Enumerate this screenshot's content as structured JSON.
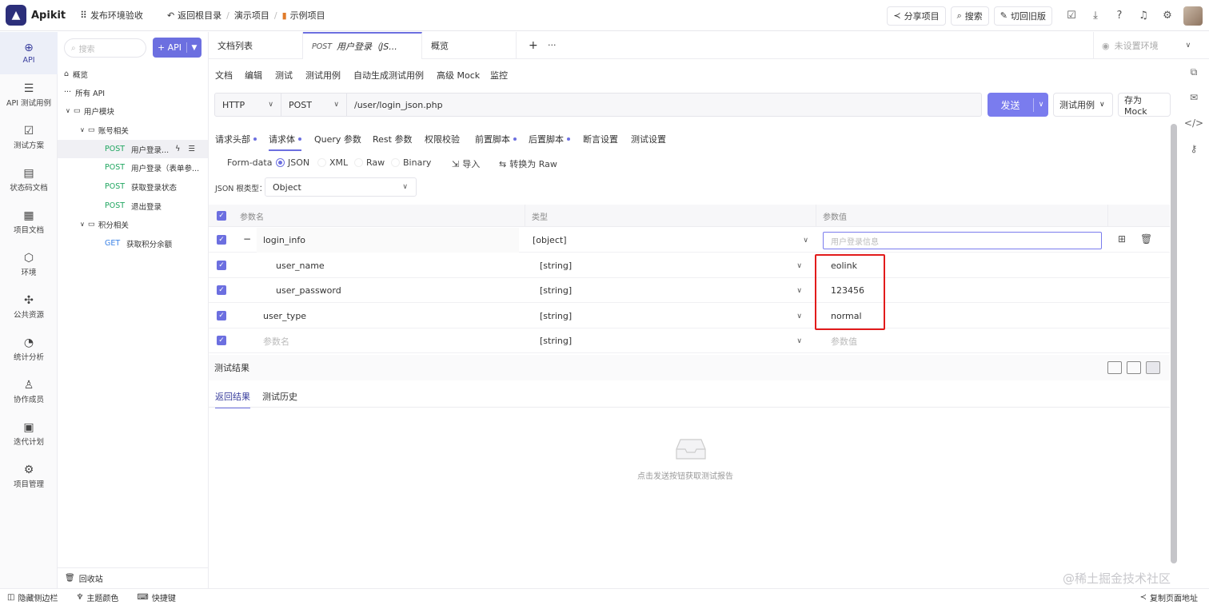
{
  "topbar": {
    "brand": "Apikit",
    "env_release": "发布环境验收",
    "back_root": "返回根目录",
    "crumb1": "演示项目",
    "crumb2": "示例项目",
    "share": "分享项目",
    "search": "搜索",
    "switch_old": "切回旧版"
  },
  "rail": [
    {
      "label": "API",
      "icon": "api-icon"
    },
    {
      "label": "API 测试用例",
      "icon": "test-case-icon"
    },
    {
      "label": "测试方案",
      "icon": "test-plan-icon"
    },
    {
      "label": "状态码文档",
      "icon": "status-doc-icon"
    },
    {
      "label": "项目文档",
      "icon": "project-doc-icon"
    },
    {
      "label": "环境",
      "icon": "env-icon"
    },
    {
      "label": "公共资源",
      "icon": "puzzle-icon"
    },
    {
      "label": "统计分析",
      "icon": "chart-icon"
    },
    {
      "label": "协作成员",
      "icon": "members-icon"
    },
    {
      "label": "迭代计划",
      "icon": "calendar-icon"
    },
    {
      "label": "项目管理",
      "icon": "gear-icon"
    }
  ],
  "tree": {
    "search_placeholder": "搜索",
    "add_api": "+ API",
    "overview": "概览",
    "all_api": "所有 API",
    "group_user": "用户模块",
    "group_account": "账号相关",
    "item1": {
      "method": "POST",
      "name": "用户登录..."
    },
    "item2": {
      "method": "POST",
      "name": "用户登录（表单参..."
    },
    "item3": {
      "method": "POST",
      "name": "获取登录状态"
    },
    "item4": {
      "method": "POST",
      "name": "退出登录"
    },
    "group_points": "积分相关",
    "item5": {
      "method": "GET",
      "name": "获取积分余额"
    },
    "recycle": "回收站"
  },
  "tabs": {
    "doc_list": "文档列表",
    "active_method": "POST",
    "active_name": "用户登录（JS...",
    "overview": "概览",
    "plus": "+",
    "more": "···",
    "env": "未设置环境"
  },
  "subtabs": [
    "文档",
    "编辑",
    "测试",
    "测试用例",
    "自动生成测试用例",
    "高级 Mock",
    "监控"
  ],
  "url": {
    "protocol": "HTTP",
    "method": "POST",
    "path": "/user/login_json.php",
    "send": "发送",
    "test_case": "测试用例",
    "save_mock": "存为 Mock"
  },
  "reqtabs": [
    "请求头部",
    "请求体",
    "Query 参数",
    "Rest 参数",
    "权限校验",
    "前置脚本",
    "后置脚本",
    "断言设置",
    "测试设置"
  ],
  "body_types": [
    "Form-data",
    "JSON",
    "XML",
    "Raw",
    "Binary"
  ],
  "body_actions": {
    "import": "导入",
    "to_raw": "转换为 Raw"
  },
  "json_root": {
    "label": "JSON 根类型：",
    "value": "Object"
  },
  "table": {
    "headers": {
      "name": "参数名",
      "type": "类型",
      "value": "参数值"
    },
    "rows": [
      {
        "name": "login_info",
        "type": "[object]",
        "value_placeholder": "用户登录信息"
      },
      {
        "name": "user_name",
        "type": "[string]",
        "value": "eolink"
      },
      {
        "name": "user_password",
        "type": "[string]",
        "value": "123456"
      },
      {
        "name": "user_type",
        "type": "[string]",
        "value": "normal"
      },
      {
        "name_placeholder": "参数名",
        "type": "[string]",
        "value_placeholder": "参数值"
      }
    ]
  },
  "results": {
    "title": "测试结果",
    "tab_return": "返回结果",
    "tab_history": "测试历史",
    "empty": "点击发送按钮获取测试报告"
  },
  "bottom": {
    "hide_sidebar": "隐藏侧边栏",
    "theme": "主题颜色",
    "shortcuts": "快捷键",
    "copy_url": "复制页面地址"
  },
  "watermark": "@稀土掘金技术社区",
  "colors": {
    "accent": "#6c6fe0",
    "post": "#20a660",
    "get": "#3c83e6",
    "highlight": "#e21b1b"
  }
}
